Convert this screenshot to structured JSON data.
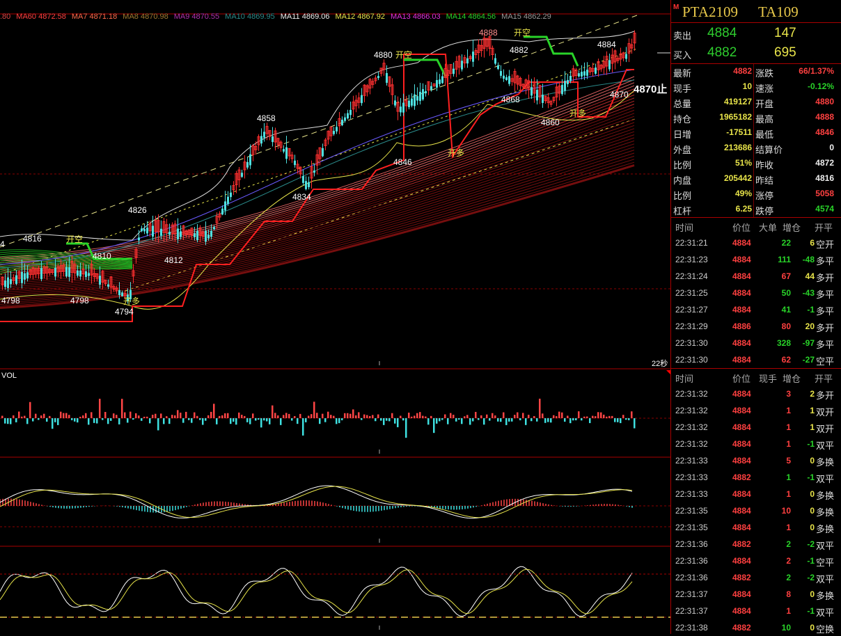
{
  "ma_legend": [
    {
      "label": ".80",
      "color": "#d44"
    },
    {
      "label": "MA60 4872.58",
      "color": "#ff4040"
    },
    {
      "label": "MA7 4871.18",
      "color": "#ff6a4a"
    },
    {
      "label": "MA8 4870.98",
      "color": "#a07a30"
    },
    {
      "label": "MA9 4870.55",
      "color": "#b030b0"
    },
    {
      "label": "MA10 4869.95",
      "color": "#2a8a8a"
    },
    {
      "label": "MA11 4869.06",
      "color": "#eeeeee"
    },
    {
      "label": "MA12 4867.92",
      "color": "#e8e44a"
    },
    {
      "label": "MA13 4866.03",
      "color": "#e030e0"
    },
    {
      "label": "MA14 4864.56",
      "color": "#29d329"
    },
    {
      "label": "MA15 4862.29",
      "color": "#999999"
    }
  ],
  "chart_labels": {
    "p4888": "4888",
    "p4882": "4882",
    "p4884": "4884",
    "p4880": "4880",
    "p4858": "4858",
    "p4868": "4868",
    "p4860": "4860",
    "p4846": "4846",
    "p4834": "4834",
    "p4826": "4826",
    "p4870": "4870",
    "p4816": "4816",
    "p4810": "4810",
    "p4812": "4812",
    "p4798a": "4798",
    "p4798b": "4798",
    "p4794": "4794",
    "p4edge": "4",
    "kaikong1": "开空",
    "kaikong2": "开空",
    "kaikong3": "开空",
    "kaiduo1": "开多",
    "kaiduo2": "开多",
    "kaiduo3": "开多",
    "stop": "4870止",
    "timer": "22秒",
    "vol": "VOL"
  },
  "instrument": {
    "mark": "M",
    "symbol": "PTA2109",
    "code": "TA109"
  },
  "bidask": {
    "sell_label": "卖出",
    "sell_price": "4884",
    "sell_qty": "147",
    "buy_label": "买入",
    "buy_price": "4882",
    "buy_qty": "695"
  },
  "stats_left": [
    {
      "k": "最新",
      "v": "4882",
      "c": "red"
    },
    {
      "k": "现手",
      "v": "10",
      "c": "yel"
    },
    {
      "k": "总量",
      "v": "419127",
      "c": "yel"
    },
    {
      "k": "持仓",
      "v": "1965182",
      "c": "yel"
    },
    {
      "k": "日增",
      "v": "-17511",
      "c": "yel"
    },
    {
      "k": "外盘",
      "v": "213686",
      "c": "yel"
    },
    {
      "k": "比例",
      "v": "51%",
      "c": "yel"
    },
    {
      "k": "内盘",
      "v": "205442",
      "c": "yel"
    },
    {
      "k": "比例",
      "v": "49%",
      "c": "yel"
    },
    {
      "k": "杠杆",
      "v": "6.25",
      "c": "yel"
    }
  ],
  "stats_right": [
    {
      "k": "涨跌",
      "v": "66/1.37%",
      "c": "red"
    },
    {
      "k": "速涨",
      "v": "-0.12%",
      "c": "grn"
    },
    {
      "k": "开盘",
      "v": "4880",
      "c": "red"
    },
    {
      "k": "最高",
      "v": "4888",
      "c": "red"
    },
    {
      "k": "最低",
      "v": "4846",
      "c": "red"
    },
    {
      "k": "结算价",
      "v": "0",
      "c": "wht"
    },
    {
      "k": "昨收",
      "v": "4872",
      "c": "wht"
    },
    {
      "k": "昨结",
      "v": "4816",
      "c": "wht"
    },
    {
      "k": "涨停",
      "v": "5058",
      "c": "red"
    },
    {
      "k": "跌停",
      "v": "4574",
      "c": "grn"
    }
  ],
  "ticks_header": {
    "time": "时间",
    "price": "价位",
    "qty": "大单",
    "chg": "增仓",
    "type": "开平"
  },
  "ticks_big": [
    {
      "t": "22:31:21",
      "p": "4884",
      "q": "22",
      "qc": "grn",
      "c": "6",
      "x": "空开"
    },
    {
      "t": "22:31:23",
      "p": "4884",
      "q": "111",
      "qc": "grn",
      "c": "-48",
      "x": "多平"
    },
    {
      "t": "22:31:24",
      "p": "4884",
      "q": "67",
      "qc": "red",
      "c": "44",
      "x": "多开"
    },
    {
      "t": "22:31:25",
      "p": "4884",
      "q": "50",
      "qc": "grn",
      "c": "-43",
      "x": "多平"
    },
    {
      "t": "22:31:27",
      "p": "4884",
      "q": "41",
      "qc": "grn",
      "c": "-1",
      "x": "多平"
    },
    {
      "t": "22:31:29",
      "p": "4886",
      "q": "80",
      "qc": "red",
      "c": "20",
      "x": "多开"
    },
    {
      "t": "22:31:30",
      "p": "4884",
      "q": "328",
      "qc": "grn",
      "c": "-97",
      "x": "多平"
    },
    {
      "t": "22:31:30",
      "p": "4884",
      "q": "62",
      "qc": "red",
      "c": "-27",
      "x": "空平"
    }
  ],
  "ticks_header2": {
    "time": "时间",
    "price": "价位",
    "qty": "现手",
    "chg": "增仓",
    "type": "开平"
  },
  "ticks": [
    {
      "t": "22:31:32",
      "p": "4884",
      "q": "3",
      "qc": "red",
      "c": "2",
      "x": "多开"
    },
    {
      "t": "22:31:32",
      "p": "4884",
      "q": "1",
      "qc": "red",
      "c": "1",
      "x": "双开"
    },
    {
      "t": "22:31:32",
      "p": "4884",
      "q": "1",
      "qc": "red",
      "c": "1",
      "x": "双开"
    },
    {
      "t": "22:31:32",
      "p": "4884",
      "q": "1",
      "qc": "red",
      "c": "-1",
      "x": "双平"
    },
    {
      "t": "22:31:33",
      "p": "4884",
      "q": "5",
      "qc": "red",
      "c": "0",
      "x": "多换"
    },
    {
      "t": "22:31:33",
      "p": "4882",
      "q": "1",
      "qc": "grn",
      "c": "-1",
      "x": "双平"
    },
    {
      "t": "22:31:33",
      "p": "4884",
      "q": "1",
      "qc": "red",
      "c": "0",
      "x": "多换"
    },
    {
      "t": "22:31:35",
      "p": "4884",
      "q": "10",
      "qc": "red",
      "c": "0",
      "x": "多换"
    },
    {
      "t": "22:31:35",
      "p": "4884",
      "q": "1",
      "qc": "red",
      "c": "0",
      "x": "多换"
    },
    {
      "t": "22:31:36",
      "p": "4882",
      "q": "2",
      "qc": "grn",
      "c": "-2",
      "x": "双平"
    },
    {
      "t": "22:31:36",
      "p": "4884",
      "q": "2",
      "qc": "red",
      "c": "-1",
      "x": "空平"
    },
    {
      "t": "22:31:36",
      "p": "4882",
      "q": "2",
      "qc": "grn",
      "c": "-2",
      "x": "双平"
    },
    {
      "t": "22:31:37",
      "p": "4884",
      "q": "8",
      "qc": "red",
      "c": "0",
      "x": "多换"
    },
    {
      "t": "22:31:37",
      "p": "4884",
      "q": "1",
      "qc": "red",
      "c": "-1",
      "x": "双平"
    },
    {
      "t": "22:31:38",
      "p": "4882",
      "q": "10",
      "qc": "grn",
      "c": "0",
      "x": "空换"
    }
  ]
}
